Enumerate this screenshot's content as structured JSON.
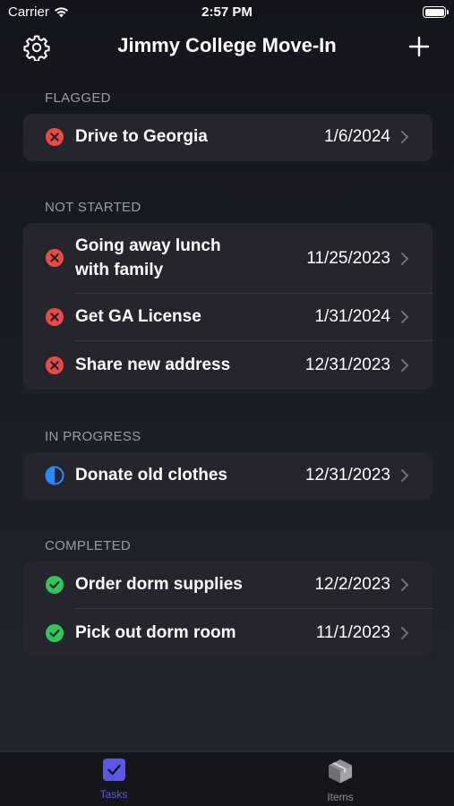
{
  "status_bar": {
    "carrier": "Carrier",
    "time": "2:57 PM"
  },
  "nav": {
    "title": "Jimmy College Move-In",
    "settings_icon": "gear-icon",
    "add_icon": "plus-icon"
  },
  "sections": {
    "flagged": {
      "header": "FLAGGED",
      "items": [
        {
          "name": "Drive to Georgia",
          "date": "1/6/2024",
          "status": "not-started"
        }
      ]
    },
    "not_started": {
      "header": "NOT STARTED",
      "items": [
        {
          "name": "Going away lunch",
          "name2": "with family",
          "date": "11/25/2023",
          "status": "not-started"
        },
        {
          "name": "Get GA License",
          "date": "1/31/2024",
          "status": "not-started"
        },
        {
          "name": "Share new address",
          "date": "12/31/2023",
          "status": "not-started"
        }
      ]
    },
    "in_progress": {
      "header": "IN PROGRESS",
      "items": [
        {
          "name": "Donate old clothes",
          "date": "12/31/2023",
          "status": "in-progress"
        }
      ]
    },
    "completed": {
      "header": "COMPLETED",
      "items": [
        {
          "name": "Order dorm supplies",
          "date": "12/2/2023",
          "status": "completed"
        },
        {
          "name": "Pick out dorm room",
          "date": "11/1/2023",
          "status": "completed"
        }
      ]
    }
  },
  "tabbar": {
    "tasks": {
      "label": "Tasks",
      "icon": "checkbox-icon",
      "selected": true
    },
    "items": {
      "label": "Items",
      "icon": "box-icon",
      "selected": false
    }
  },
  "colors": {
    "accent": "#5b57e8",
    "not_started": "#eb4b43",
    "in_progress": "#2b8cff",
    "completed": "#32c55c"
  }
}
